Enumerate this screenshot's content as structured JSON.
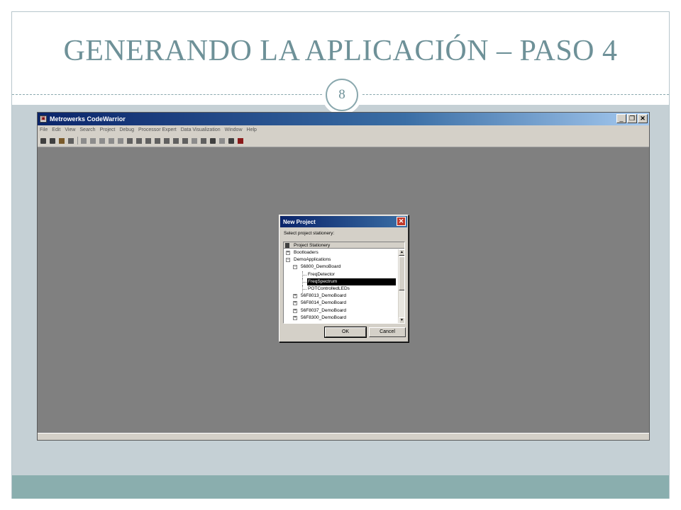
{
  "slide": {
    "title": "GENERANDO LA APLICACIÓN – PASO 4",
    "page_number": "8"
  },
  "app": {
    "window_title": "Metrowerks CodeWarrior",
    "app_icon": "codewarrior-icon",
    "window_buttons": [
      "_",
      "❐",
      "✕"
    ],
    "menu": [
      "File",
      "Edit",
      "View",
      "Search",
      "Project",
      "Debug",
      "Processor Expert",
      "Data Visualization",
      "Window",
      "Help"
    ],
    "toolbar_icons": [
      "new-text-file-icon",
      "new-project-icon",
      "open-icon",
      "save-icon",
      "undo-icon",
      "redo-icon",
      "cut-icon",
      "copy-icon",
      "paste-icon",
      "find-icon",
      "bring-up-to-date-icon",
      "make-icon",
      "debug-icon",
      "run-icon",
      "stop-icon",
      "reset-icon",
      "step-icon",
      "breakpoint-icon",
      "compile-icon",
      "processor-expert-icon",
      "disassemble-icon",
      "settings-icon"
    ]
  },
  "dialog": {
    "title": "New Project",
    "close_label": "✕",
    "prompt": "Select project stationery:",
    "tree_header": "Project Stationery",
    "tree": [
      {
        "label": "Bootloaders",
        "level": 0,
        "expander": "+",
        "selected": false
      },
      {
        "label": "DemoApplications",
        "level": 0,
        "expander": "−",
        "selected": false
      },
      {
        "label": "56800_DemoBoard",
        "level": 1,
        "expander": "−",
        "selected": false
      },
      {
        "label": "FreqDetector",
        "level": 2,
        "expander": "",
        "selected": false
      },
      {
        "label": "FreqSpectrum",
        "level": 2,
        "expander": "",
        "selected": true
      },
      {
        "label": "POTControlledLEDs",
        "level": 2,
        "expander": "",
        "selected": false
      },
      {
        "label": "56F8013_DemoBoard",
        "level": 1,
        "expander": "+",
        "selected": false
      },
      {
        "label": "56F8014_DemoBoard",
        "level": 1,
        "expander": "+",
        "selected": false
      },
      {
        "label": "56F8037_DemoBoard",
        "level": 1,
        "expander": "+",
        "selected": false
      },
      {
        "label": "56F8300_DemoBoard",
        "level": 1,
        "expander": "+",
        "selected": false
      }
    ],
    "ok_label": "OK",
    "cancel_label": "Cancel"
  },
  "colors": {
    "title": "#6e9198",
    "content_band": "#c5d0d5",
    "footer_band": "#8aaeae",
    "workspace": "#808080",
    "titlebar_start": "#0a246a",
    "selection": "#000000"
  }
}
